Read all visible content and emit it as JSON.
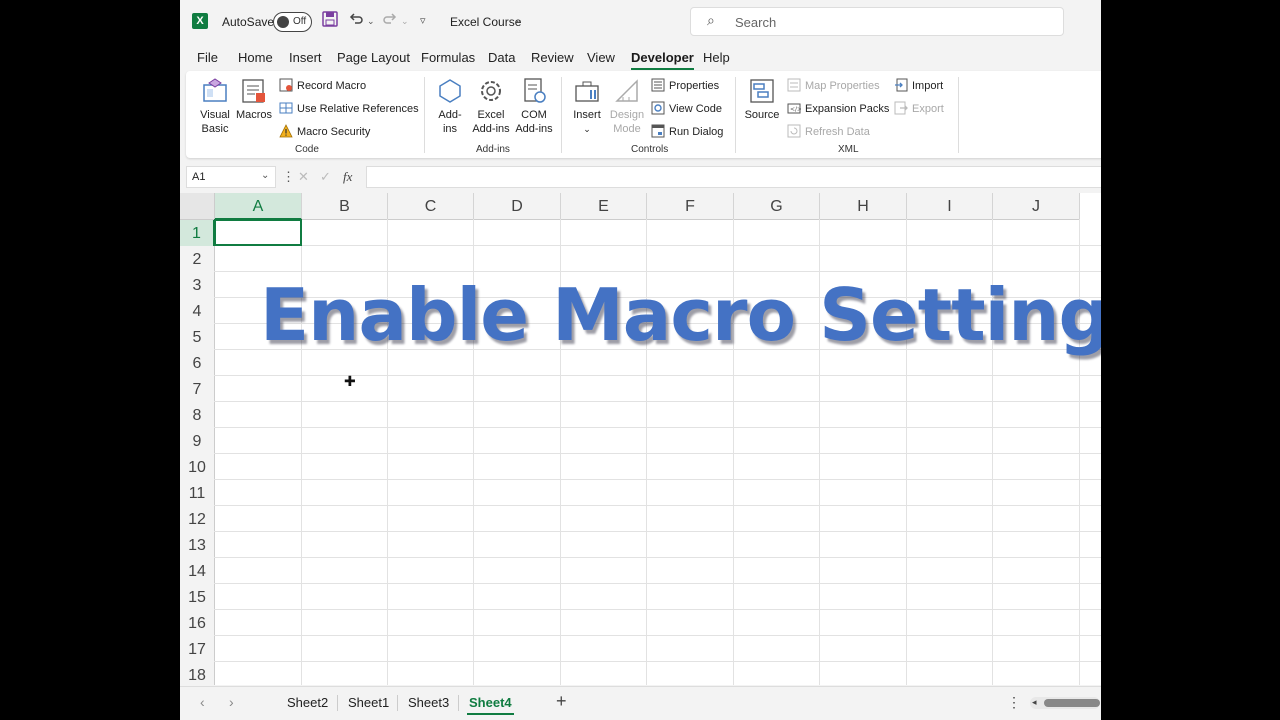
{
  "titlebar": {
    "autosave_label": "AutoSave",
    "autosave_state": "Off",
    "document_title": "Excel Course",
    "search_placeholder": "Search"
  },
  "menu": {
    "tabs": [
      "File",
      "Home",
      "Insert",
      "Page Layout",
      "Formulas",
      "Data",
      "Review",
      "View",
      "Developer",
      "Help"
    ],
    "active": "Developer"
  },
  "ribbon": {
    "code": {
      "label": "Code",
      "visual_basic": [
        "Visual",
        "Basic"
      ],
      "macros": "Macros",
      "record_macro": "Record Macro",
      "use_relative_references": "Use Relative References",
      "macro_security": "Macro Security"
    },
    "addins": {
      "label": "Add-ins",
      "addins": [
        "Add-",
        "ins"
      ],
      "excel_addins": [
        "Excel",
        "Add-ins"
      ],
      "com_addins": [
        "COM",
        "Add-ins"
      ]
    },
    "controls": {
      "label": "Controls",
      "insert": "Insert",
      "design_mode": [
        "Design",
        "Mode"
      ],
      "properties": "Properties",
      "view_code": "View Code",
      "run_dialog": "Run Dialog"
    },
    "xml": {
      "label": "XML",
      "source": "Source",
      "map_properties": "Map Properties",
      "expansion_packs": "Expansion Packs",
      "refresh_data": "Refresh Data",
      "import": "Import",
      "export": "Export"
    }
  },
  "formula_bar": {
    "name_box": "A1",
    "fx": "fx",
    "value": ""
  },
  "grid": {
    "columns": [
      "A",
      "B",
      "C",
      "D",
      "E",
      "F",
      "G",
      "H",
      "I",
      "J"
    ],
    "rows": [
      "1",
      "2",
      "3",
      "4",
      "5",
      "6",
      "7",
      "8",
      "9",
      "10",
      "11",
      "12",
      "13",
      "14",
      "15",
      "16",
      "17",
      "18"
    ],
    "active_cell": "A1"
  },
  "overlay_text": "Enable Macro Settings",
  "sheets": {
    "tabs": [
      "Sheet2",
      "Sheet1",
      "Sheet3",
      "Sheet4"
    ],
    "active": "Sheet4"
  },
  "colors": {
    "excel_green": "#107c41",
    "overlay_blue": "#4472c4"
  }
}
